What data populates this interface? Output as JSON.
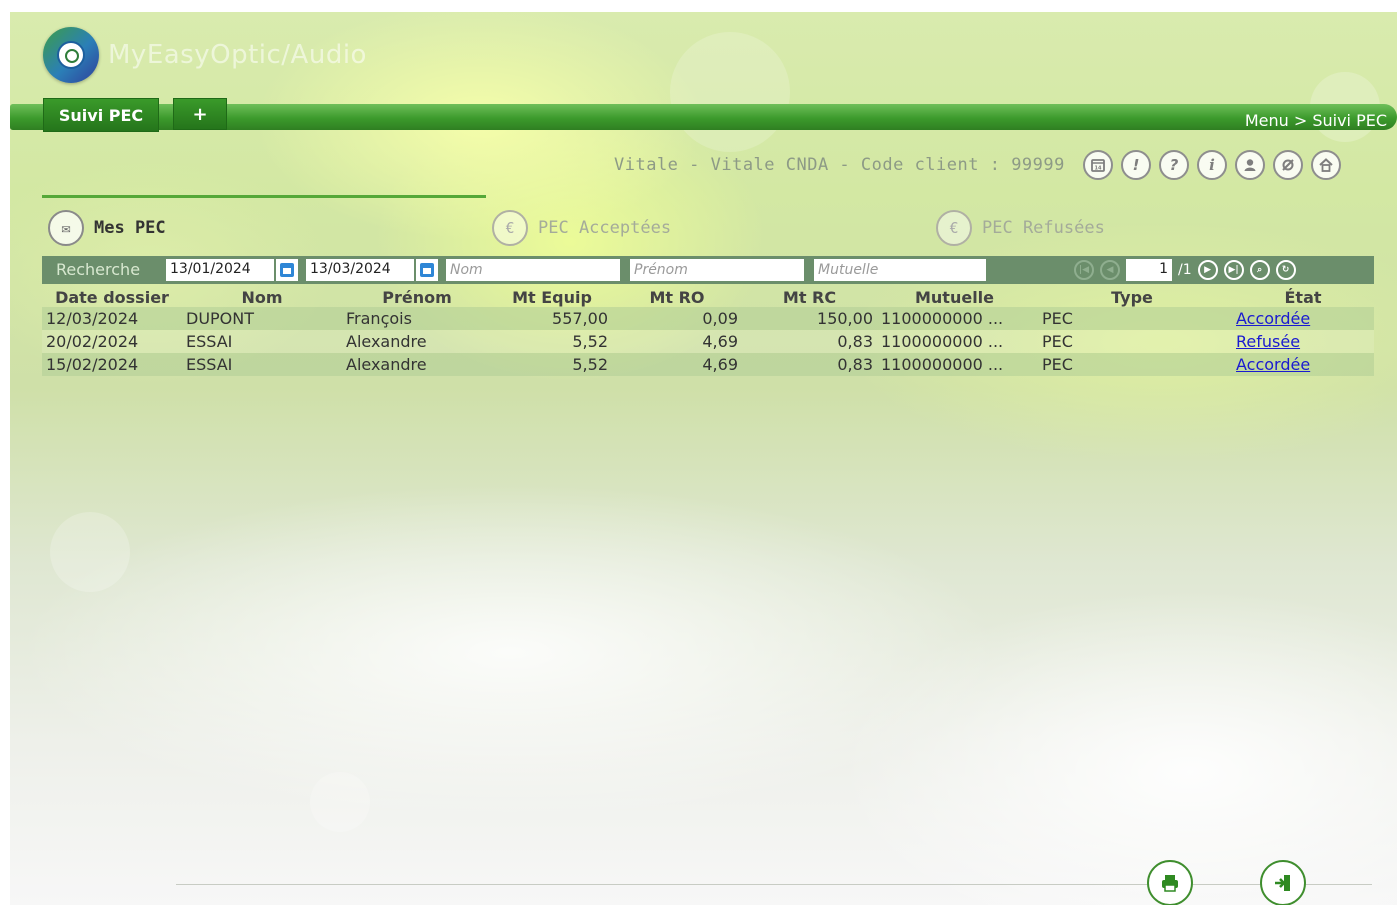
{
  "app": {
    "name": "MyEasyOptic/Audio"
  },
  "nav": {
    "active_tab": "Suivi PEC",
    "add_tab": "+",
    "breadcrumb": "Menu > Suivi PEC"
  },
  "header": {
    "client_info": "Vitale - Vitale CNDA - Code client : 99999",
    "icons": [
      "calendar-icon",
      "alert-icon",
      "help-icon",
      "info-icon",
      "user-icon",
      "settings-icon",
      "home-icon"
    ]
  },
  "sections": [
    {
      "label": "Mes PEC",
      "active": true,
      "icon": "euro-envelope-icon"
    },
    {
      "label": "PEC Acceptées",
      "active": false,
      "icon": "euro-check-icon"
    },
    {
      "label": "PEC Refusées",
      "active": false,
      "icon": "euro-cross-icon"
    }
  ],
  "search": {
    "label": "Recherche",
    "date_from": "13/01/2024",
    "date_to": "13/03/2024",
    "nom_placeholder": "Nom",
    "prenom_placeholder": "Prénom",
    "mutuelle_placeholder": "Mutuelle",
    "page": "1",
    "page_total": "/1"
  },
  "table": {
    "columns": [
      "Date dossier",
      "Nom",
      "Prénom",
      "Mt Equip",
      "Mt RO",
      "Mt RC",
      "Mutuelle",
      "Type",
      "État"
    ],
    "rows": [
      {
        "date": "12/03/2024",
        "nom": "DUPONT",
        "prenom": "François",
        "mt_equip": "557,00",
        "mt_ro": "0,09",
        "mt_rc": "150,00",
        "mutuelle": "1100000000 ...",
        "type": "PEC",
        "etat": "Accordée"
      },
      {
        "date": "20/02/2024",
        "nom": "ESSAI",
        "prenom": "Alexandre",
        "mt_equip": "5,52",
        "mt_ro": "4,69",
        "mt_rc": "0,83",
        "mutuelle": "1100000000 ...",
        "type": "PEC",
        "etat": "Refusée"
      },
      {
        "date": "15/02/2024",
        "nom": "ESSAI",
        "prenom": "Alexandre",
        "mt_equip": "5,52",
        "mt_ro": "4,69",
        "mt_rc": "0,83",
        "mutuelle": "1100000000 ...",
        "type": "PEC",
        "etat": "Accordée"
      }
    ]
  },
  "footer": {
    "icons": [
      "print-icon",
      "exit-icon"
    ]
  },
  "colors": {
    "bar_green": "#3c9a2c",
    "search_bar": "#6b8e6b",
    "link": "#1a1ad0"
  }
}
